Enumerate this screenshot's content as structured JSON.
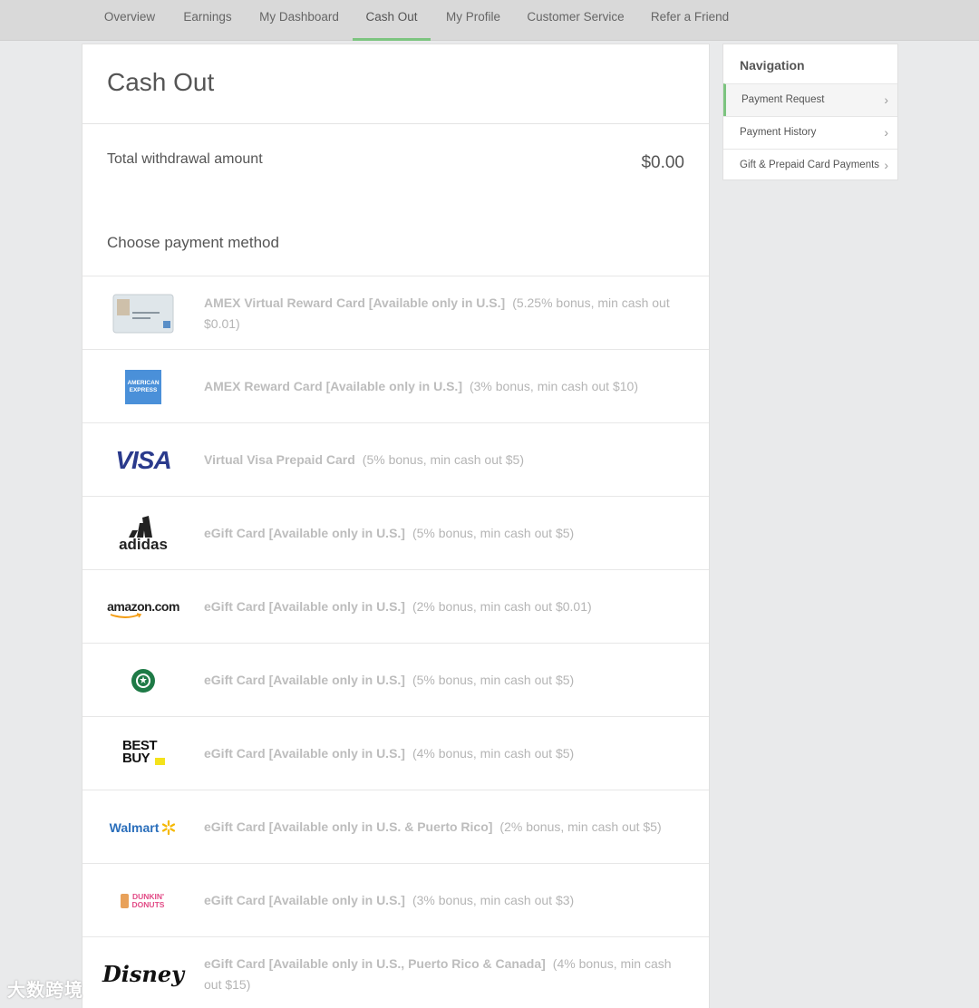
{
  "topnav": {
    "items": [
      "Overview",
      "Earnings",
      "My Dashboard",
      "Cash Out",
      "My Profile",
      "Customer Service",
      "Refer a Friend"
    ],
    "active": "Cash Out"
  },
  "main": {
    "title": "Cash Out",
    "total_label": "Total withdrawal amount",
    "total_amount": "$0.00",
    "choose_label": "Choose payment method",
    "methods": [
      {
        "logo": "amex-virtual-card-icon",
        "name": "AMEX Virtual Reward Card [Available only in U.S.]",
        "detail": "(5.25% bonus, min cash out $0.01)"
      },
      {
        "logo": "american-express-icon",
        "logo_text": "AMERICAN EXPRESS",
        "name": "AMEX Reward Card [Available only in U.S.]",
        "detail": "(3% bonus, min cash out $10)"
      },
      {
        "logo": "visa-icon",
        "logo_text": "VISA",
        "name": "Virtual Visa Prepaid Card",
        "detail": "(5% bonus, min cash out $5)"
      },
      {
        "logo": "adidas-icon",
        "logo_text": "adidas",
        "name": "eGift Card [Available only in U.S.]",
        "detail": "(5% bonus, min cash out $5)"
      },
      {
        "logo": "amazon-icon",
        "logo_text": "amazon.com",
        "name": "eGift Card [Available only in U.S.]",
        "detail": "(2% bonus, min cash out $0.01)"
      },
      {
        "logo": "starbucks-icon",
        "name": "eGift Card [Available only in U.S.]",
        "detail": "(5% bonus, min cash out $5)"
      },
      {
        "logo": "best-buy-icon",
        "logo_text": "BEST BUY",
        "name": "eGift Card [Available only in U.S.]",
        "detail": "(4% bonus, min cash out $5)"
      },
      {
        "logo": "walmart-icon",
        "logo_text": "Walmart",
        "name": "eGift Card [Available only in U.S. & Puerto Rico]",
        "detail": "(2% bonus, min cash out $5)"
      },
      {
        "logo": "dunkin-donuts-icon",
        "logo_text": "DUNKIN' DONUTS",
        "name": "eGift Card [Available only in U.S.]",
        "detail": "(3% bonus, min cash out $3)"
      },
      {
        "logo": "disney-icon",
        "logo_text": "Disney",
        "name": "eGift Card [Available only in U.S., Puerto Rico & Canada]",
        "detail": "(4% bonus, min cash out $15)"
      }
    ]
  },
  "sidebar": {
    "heading": "Navigation",
    "items": [
      "Payment Request",
      "Payment History",
      "Gift & Prepaid Card Payments"
    ],
    "active": "Payment Request"
  },
  "watermark": "大数跨境",
  "colors": {
    "accent": "#7cc47f",
    "background": "#e9eaeb"
  }
}
